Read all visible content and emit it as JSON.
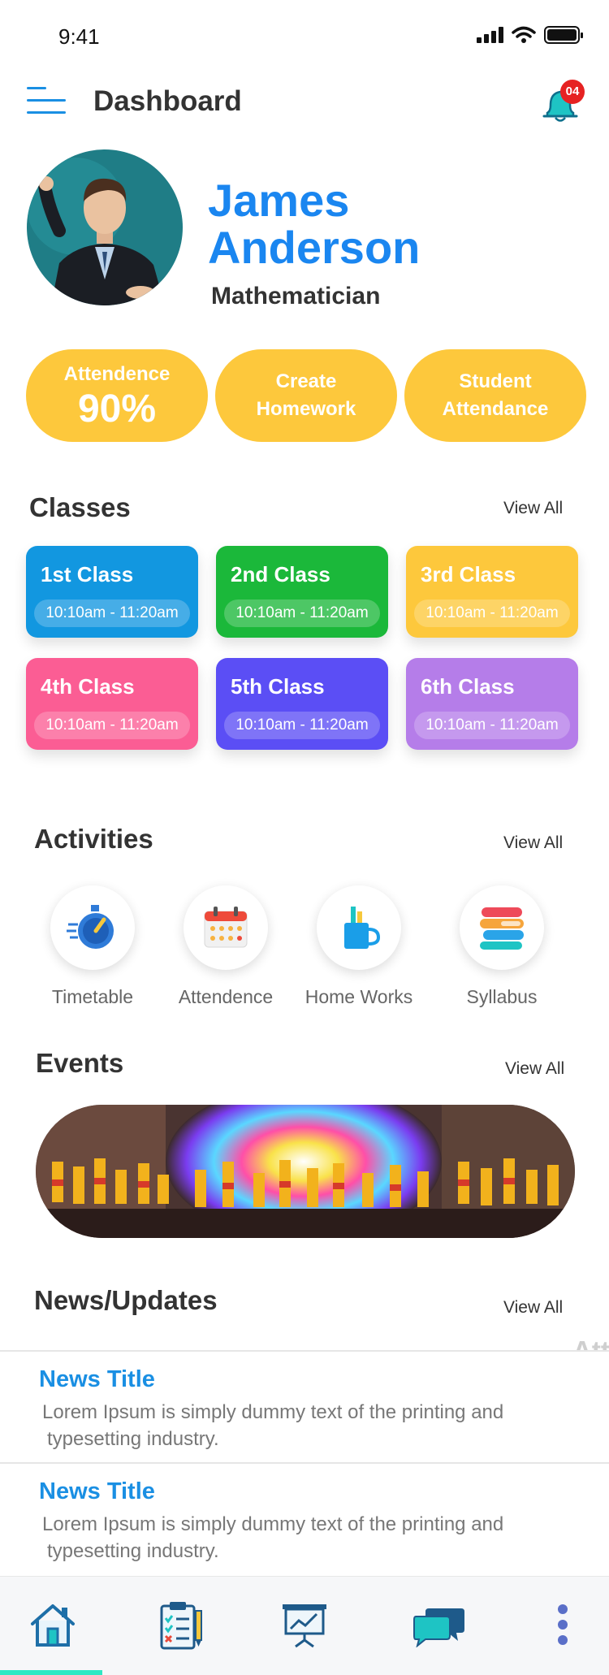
{
  "status_bar": {
    "time": "9:41"
  },
  "header": {
    "title": "Dashboard",
    "notification_count": "04"
  },
  "profile": {
    "first_name": "James",
    "last_name": "Anderson",
    "role": "Mathematician"
  },
  "quick_actions": [
    {
      "line1": "Attendence",
      "line2": "90%"
    },
    {
      "line1": "Create",
      "line2": "Homework"
    },
    {
      "line1": "Student",
      "line2": "Attendance"
    }
  ],
  "classes": {
    "title": "Classes",
    "view_all": "View All",
    "items": [
      {
        "name": "1st Class",
        "time": "10:10am - 11:20am",
        "color": "#1297e0"
      },
      {
        "name": "2nd Class",
        "time": "10:10am - 11:20am",
        "color": "#1bb83a"
      },
      {
        "name": "3rd Class",
        "time": "10:10am - 11:20am",
        "color": "#fdc83c"
      },
      {
        "name": "4th Class",
        "time": "10:10am - 11:20am",
        "color": "#fb5d94"
      },
      {
        "name": "5th Class",
        "time": "10:10am - 11:20am",
        "color": "#5b4ef5"
      },
      {
        "name": "6th Class",
        "time": "10:10am - 11:20am",
        "color": "#b57de9"
      }
    ]
  },
  "activities": {
    "title": "Activities",
    "view_all": "View All",
    "items": [
      {
        "label": "Timetable",
        "icon": "stopwatch-icon"
      },
      {
        "label": "Attendence",
        "icon": "calendar-icon"
      },
      {
        "label": "Home Works",
        "icon": "pencil-cup-icon"
      },
      {
        "label": "Syllabus",
        "icon": "books-icon"
      }
    ]
  },
  "events": {
    "title": "Events",
    "view_all": "View All"
  },
  "news": {
    "title": "News/Updates",
    "view_all": "View All",
    "ghost_text": "Att",
    "items": [
      {
        "title": "News Title",
        "body_line1": "Lorem Ipsum is simply dummy text of the printing and",
        "body_line2": "typesetting industry."
      },
      {
        "title": "News Title",
        "body_line1": "Lorem Ipsum is simply dummy text of the printing and",
        "body_line2": "typesetting industry."
      }
    ]
  },
  "bottom_nav": [
    {
      "icon": "home-icon"
    },
    {
      "icon": "clipboard-checklist-icon"
    },
    {
      "icon": "presentation-chart-icon"
    },
    {
      "icon": "chat-bubbles-icon"
    },
    {
      "icon": "more-vertical-icon"
    }
  ],
  "colors": {
    "accent_blue": "#1a86f0",
    "pill_yellow": "#fdc83c",
    "nav_indicator": "#2ee8c4",
    "badge_red": "#e62222"
  }
}
